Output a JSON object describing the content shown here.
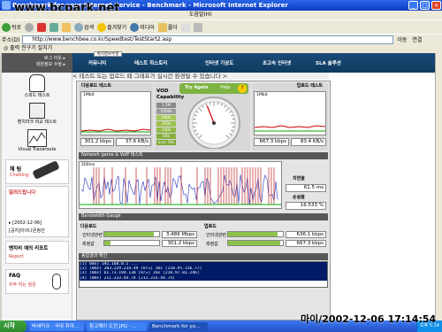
{
  "window": {
    "title": "Benchmark for your Internet Service - Benchmark - Microsoft Internet Explorer",
    "watermark": "www.bcpark.net"
  },
  "menubar": {
    "items": [
      "파일(F)",
      "편집(E)",
      "보기(V)",
      "즐겨찾기(A)",
      "도구(T)",
      "도움말(H)"
    ]
  },
  "toolbar": {
    "back": "뒤로",
    "search": "검색",
    "favorites": "즐겨찾기",
    "media": "미디어",
    "history": "폴더"
  },
  "address": {
    "label": "주소(D)",
    "url": "http://www.benchbee.co.kr/Speedtest/TestStart2.asp",
    "go": "이동",
    "links": "연결"
  },
  "favbar": {
    "text": "◎ 출력 전구기 설치기"
  },
  "sidebar": {
    "top_links": [
      "로그 아웃 ▸",
      "회원정보 수정 ▸"
    ],
    "items": [
      "스피드 테스트",
      "벤치마크 비교 테스트",
      "Visual Traceroute"
    ],
    "chatting_title": "채 팅",
    "chatting_sub": "Chatting",
    "notice_title": "알려드립니다",
    "notice_date": "▸ [2002-12-06]",
    "notice_item": "[공지]이이나온정선",
    "report_title": "벤치비 예의 리포트",
    "report_sub": "Report",
    "faq_title": "FAQ",
    "faq_sub": "자주 하는 질문"
  },
  "nav": {
    "tabs": [
      "커뮤니티",
      "테스트 히스토리",
      "인터넷 기상도",
      "초고속 인터넷",
      "SLA 솔루션"
    ],
    "small_button": "위치정보수정"
  },
  "status": {
    "message": "< 테스트 도는 업로드 때 그래프가 실시간 환경될 수 있습니다 >"
  },
  "download_test": {
    "header": "다운로드 테스트",
    "graph_label": "1Mbit",
    "value1": "301.2 kbps",
    "value2": "37.6 KB/s"
  },
  "upload_test": {
    "header": "업로드 테스트",
    "graph_label": "1Mbit",
    "value1": "667.3 kbps",
    "value2": "83.4 KB/s"
  },
  "gauge": {
    "title": "VOD Capability",
    "try_again": "Try Again",
    "help": "Help",
    "levels": [
      "1.5M",
      "1000k",
      "500k",
      "300k",
      "100k",
      "56k",
      "over 56k"
    ],
    "level_colors": [
      "#8a8a8a",
      "#9a9a9a",
      "#a5c85a",
      "#9cc04f",
      "#92b848",
      "#88b040",
      "#80a838"
    ],
    "needle_fraction": 0.42
  },
  "network": {
    "header": "Network game & VoIP 테스트",
    "graph_label": "200ms",
    "latency_label": "지연율",
    "latency_value": "61.5 ms",
    "loss_label": "손실율",
    "loss_value": "16.533 %"
  },
  "bandwidth": {
    "header": "Bandwidth Gauge",
    "download_label": "다운로드",
    "upload_label": "업로드",
    "dl_row1_label": "인터넷관련",
    "dl_row1_value": "3.489 Mbps",
    "dl_row1_fraction": 0.9,
    "dl_row2_label": "측정값",
    "dl_row2_value": "301.2 kbps",
    "dl_row2_fraction": 0.12,
    "ul_row1_label": "인터넷관련",
    "ul_row1_value": "636.1 kbps",
    "ul_row1_fraction": 0.9,
    "ul_row2_label": "측정값",
    "ul_row2_value": "667.3 kbps",
    "ul_row2_fraction": 0.95
  },
  "trace": {
    "header": "종합결과 확인",
    "lines": [
      "[1] 0ms) 192.168.0.1 ...",
      "[2] (0ms) 203.229.234.49 [kr=] 1ms [210.95.156.77]",
      "[3] (0ms) 61.73.194.130 [kr=] 2ms [210.97.83.246]",
      "[4] (0ms) 211.233.44.74 [211.233.44.74]"
    ]
  },
  "taskbar": {
    "start": "시작",
    "tasks": [
      "바세미크 - 국내 최대...",
      "참고해이 도전.JPG - ...",
      "Benchmark for yo..."
    ],
    "clock": "오후 5:14"
  },
  "datestamp": "마이/2002-12-06 17:14:54"
}
